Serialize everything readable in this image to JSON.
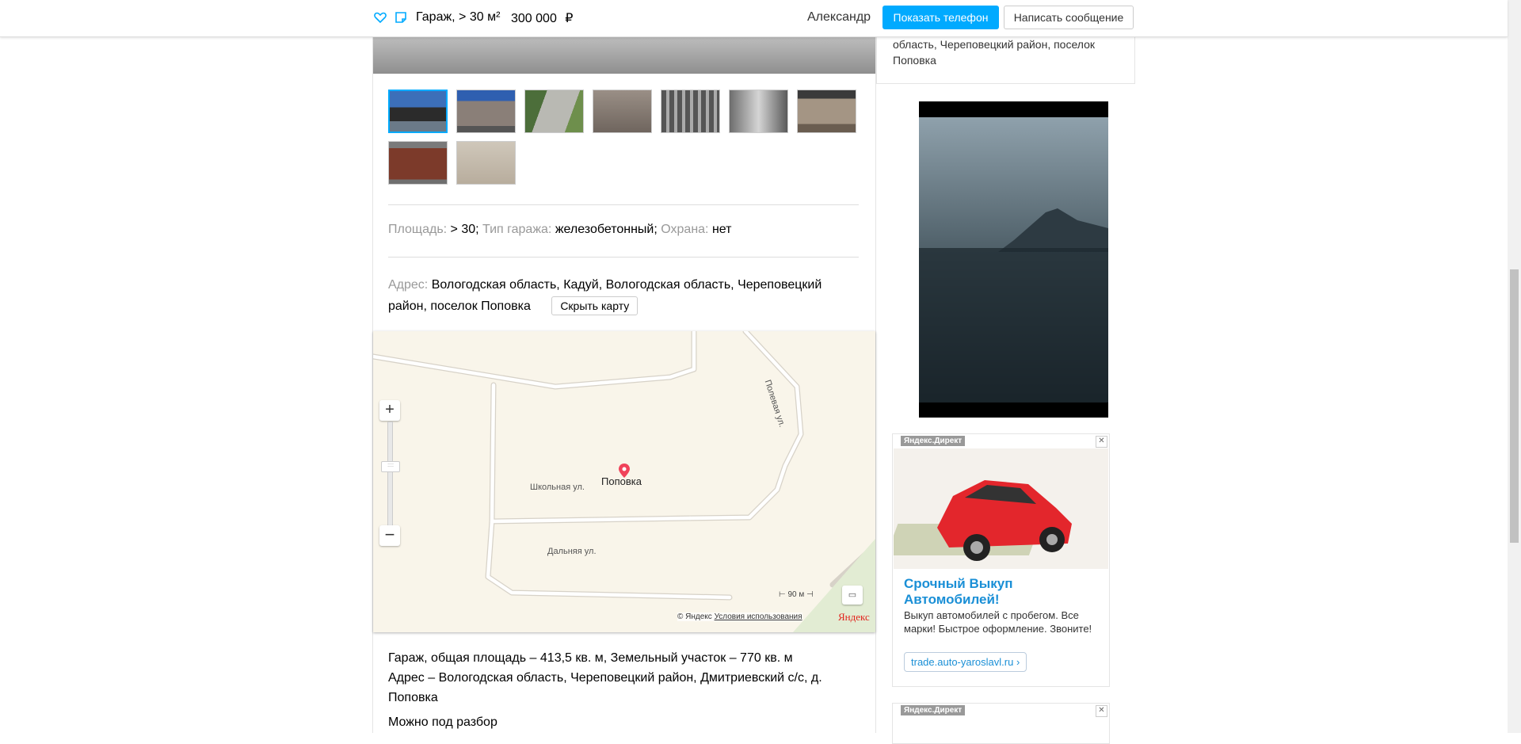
{
  "header": {
    "title": "Гараж, > 30 м²",
    "price": "300 000",
    "currency": "₽",
    "seller": "Александр",
    "show_phone": "Показать телефон",
    "write_message": "Написать сообщение"
  },
  "params": {
    "area_label": "Площадь:",
    "area_value": "> 30;",
    "type_label": "Тип гаража:",
    "type_value": "железобетонный;",
    "security_label": "Охрана:",
    "security_value": "нет"
  },
  "address": {
    "label": "Адрес:",
    "value": "Вологодская область, Кадуй, Вологодская область, Череповецкий район, поселок Поповка",
    "hide_map": "Скрыть карту"
  },
  "map": {
    "place": "Поповка",
    "streets": [
      "Полевая ул.",
      "Школьная ул.",
      "Дальняя ул."
    ],
    "scale": "90 м",
    "copyright": "© Яндекс",
    "terms": "Условия использования",
    "logo": "Яндекс"
  },
  "description": {
    "line1": "Гараж, общая площадь – 413,5 кв. м, Земельный участок – 770 кв. м",
    "line2": "Адрес – Вологодская область, Череповецкий район, Дмитриевский с/с, д. Поповка",
    "line3": "Можно под разбор"
  },
  "sidebar": {
    "address_tail": "область, Череповецкий район, поселок Поповка"
  },
  "ad": {
    "label": "Яндекс.Директ",
    "close": "✕",
    "title": "Срочный Выкуп Автомобилей!",
    "text": "Выкуп автомобилей с пробегом. Все марки! Быстрое оформление. Звоните!",
    "link": "trade.auto-yaroslavl.ru ›"
  },
  "ad2": {
    "label": "Яндекс.Директ",
    "close": "✕"
  },
  "colors": {
    "accent": "#00aaff",
    "ad_title": "#1a8fd6",
    "pin": "#f0435a"
  }
}
